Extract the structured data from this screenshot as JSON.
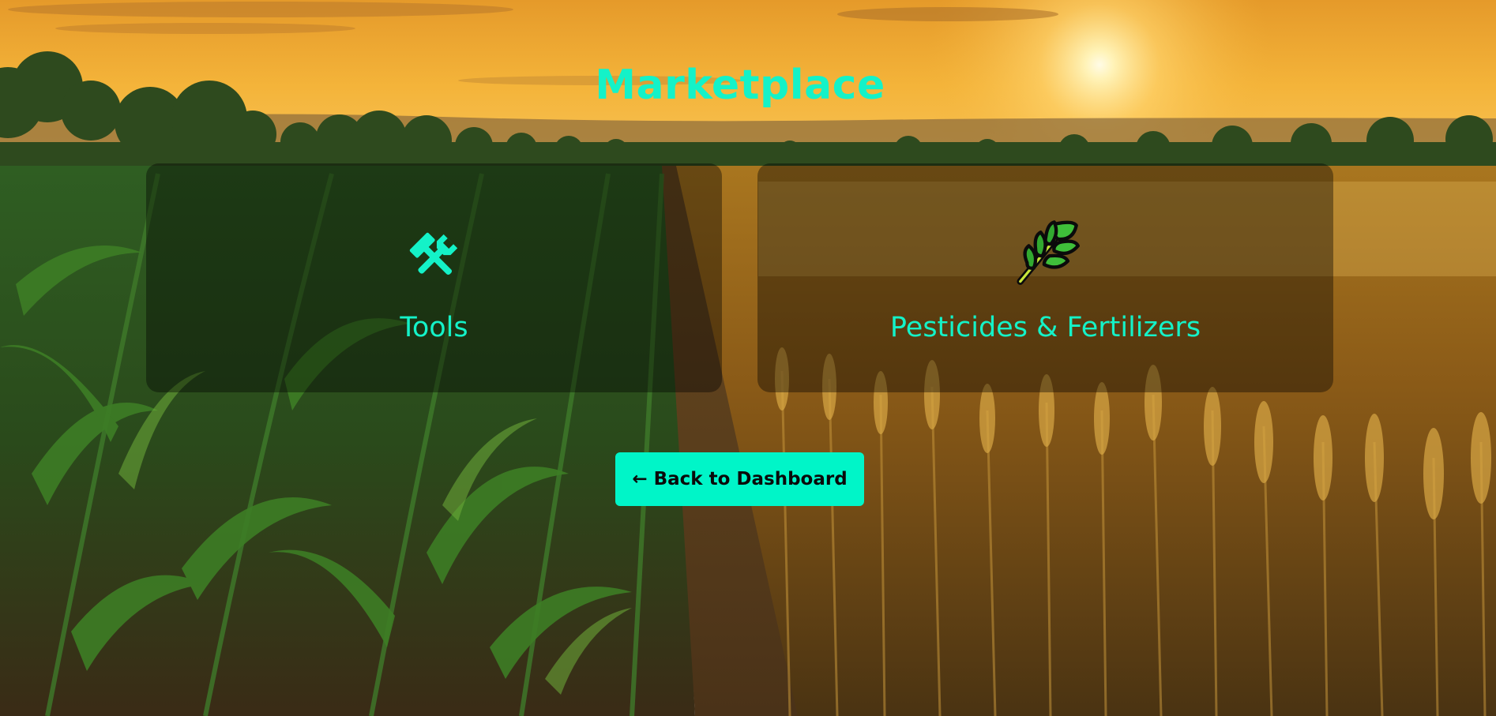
{
  "page": {
    "title": "Marketplace"
  },
  "categories": [
    {
      "label": "Tools",
      "icon": "hammer-and-wrench-icon"
    },
    {
      "label": "Pesticides & Fertilizers",
      "icon": "herb-leaf-icon"
    }
  ],
  "actions": {
    "back_label": "← Back to Dashboard"
  },
  "colors": {
    "accent": "#14f2c8",
    "button": "#00f5c8",
    "button_text": "#0a0a0a"
  }
}
